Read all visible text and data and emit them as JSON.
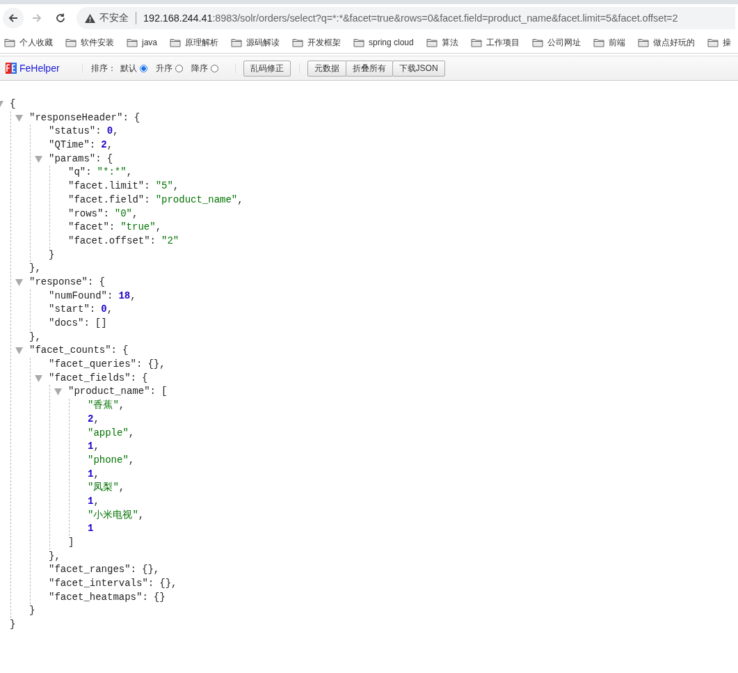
{
  "browser": {
    "nav": [
      {
        "kind": "back",
        "disabled": false
      },
      {
        "kind": "forward",
        "disabled": true
      },
      {
        "kind": "reload",
        "disabled": false
      }
    ],
    "security": "不安全",
    "url_host": "192.168.244.41",
    "url_rest": ":8983/solr/orders/select?q=*:*&facet=true&rows=0&facet.field=product_name&facet.limit=5&facet.offset=2"
  },
  "bookmarks": [
    "个人收藏",
    "软件安装",
    "java",
    "原理解析",
    "源码解读",
    "开发框架",
    "spring cloud",
    "算法",
    "工作项目",
    "公司网址",
    "前端",
    "做点好玩的",
    "操"
  ],
  "fehelper": {
    "name": "FeHelper",
    "sort_label": "排序：",
    "sort_options": [
      {
        "label": "默认",
        "selected": true
      },
      {
        "label": "升序",
        "selected": false
      },
      {
        "label": "降序",
        "selected": false
      }
    ],
    "fix_button": "乱码修正",
    "buttons": [
      "元数据",
      "折叠所有",
      "下载JSON"
    ]
  },
  "json": {
    "open": "{",
    "expanded": true,
    "close": "}",
    "children": [
      {
        "key": "\"responseHeader\":",
        "open": "{",
        "expanded": true,
        "close": "}",
        "tail": ",",
        "children": [
          {
            "key": "\"status\":",
            "value": "0",
            "kind": "number",
            "tail": ","
          },
          {
            "key": "\"QTime\":",
            "value": "2",
            "kind": "number",
            "tail": ","
          },
          {
            "key": "\"params\":",
            "open": "{",
            "expanded": true,
            "close": "}",
            "children": [
              {
                "key": "\"q\":",
                "value": "\"*:*\"",
                "kind": "string",
                "tail": ","
              },
              {
                "key": "\"facet.limit\":",
                "value": "\"5\"",
                "kind": "string",
                "tail": ","
              },
              {
                "key": "\"facet.field\":",
                "value": "\"product_name\"",
                "kind": "string",
                "tail": ","
              },
              {
                "key": "\"rows\":",
                "value": "\"0\"",
                "kind": "string",
                "tail": ","
              },
              {
                "key": "\"facet\":",
                "value": "\"true\"",
                "kind": "string",
                "tail": ","
              },
              {
                "key": "\"facet.offset\":",
                "value": "\"2\"",
                "kind": "string"
              }
            ]
          }
        ]
      },
      {
        "key": "\"response\":",
        "open": "{",
        "expanded": true,
        "close": "}",
        "tail": ",",
        "children": [
          {
            "key": "\"numFound\":",
            "value": "18",
            "kind": "number",
            "tail": ","
          },
          {
            "key": "\"start\":",
            "value": "0",
            "kind": "number",
            "tail": ","
          },
          {
            "key": "\"docs\":",
            "value": "[]",
            "kind": "punct"
          }
        ]
      },
      {
        "key": "\"facet_counts\":",
        "open": "{",
        "expanded": true,
        "close": "}",
        "children": [
          {
            "key": "\"facet_queries\":",
            "value": "{}",
            "kind": "punct",
            "tail": ","
          },
          {
            "key": "\"facet_fields\":",
            "open": "{",
            "expanded": true,
            "close": "}",
            "tail": ",",
            "children": [
              {
                "key": "\"product_name\":",
                "open": "[",
                "expanded": true,
                "close": "]",
                "children": [
                  {
                    "value": "\"香蕉\"",
                    "kind": "string",
                    "tail": ","
                  },
                  {
                    "value": "2",
                    "kind": "number",
                    "tail": ","
                  },
                  {
                    "value": "\"apple\"",
                    "kind": "string",
                    "tail": ","
                  },
                  {
                    "value": "1",
                    "kind": "number",
                    "tail": ","
                  },
                  {
                    "value": "\"phone\"",
                    "kind": "string",
                    "tail": ","
                  },
                  {
                    "value": "1",
                    "kind": "number",
                    "tail": ","
                  },
                  {
                    "value": "\"凤梨\"",
                    "kind": "string",
                    "tail": ","
                  },
                  {
                    "value": "1",
                    "kind": "number",
                    "tail": ","
                  },
                  {
                    "value": "\"小米电视\"",
                    "kind": "string",
                    "tail": ","
                  },
                  {
                    "value": "1",
                    "kind": "number"
                  }
                ]
              }
            ]
          },
          {
            "key": "\"facet_ranges\":",
            "value": "{}",
            "kind": "punct",
            "tail": ","
          },
          {
            "key": "\"facet_intervals\":",
            "value": "{}",
            "kind": "punct",
            "tail": ","
          },
          {
            "key": "\"facet_heatmaps\":",
            "value": "{}",
            "kind": "punct"
          }
        ]
      }
    ]
  }
}
